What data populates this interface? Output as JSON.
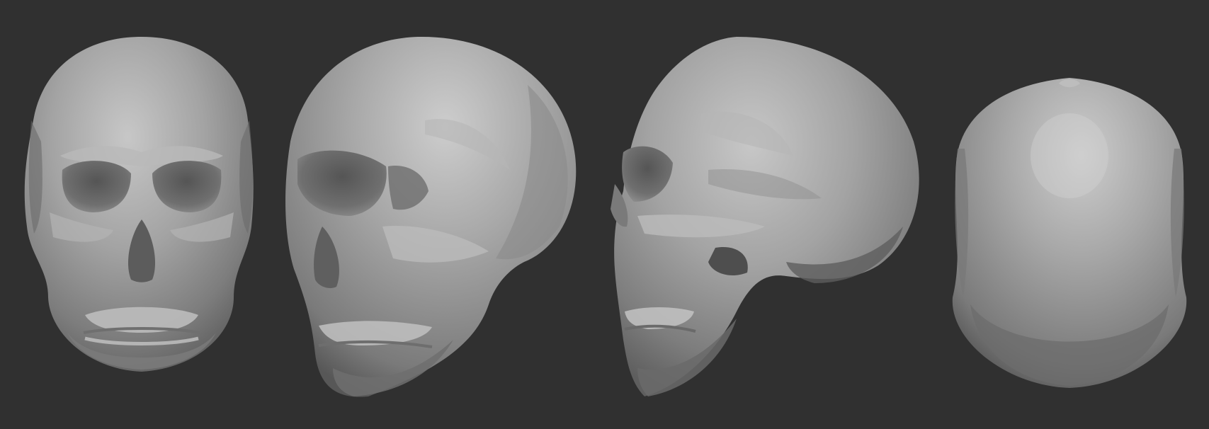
{
  "scene": {
    "background_color": "#303030",
    "material_color": "#9a9a9a",
    "views": [
      {
        "view": "front",
        "icon": "skull-front-icon"
      },
      {
        "view": "three-quarter",
        "icon": "skull-three-quarter-icon"
      },
      {
        "view": "side",
        "icon": "skull-side-icon"
      },
      {
        "view": "back",
        "icon": "skull-back-icon"
      }
    ]
  }
}
